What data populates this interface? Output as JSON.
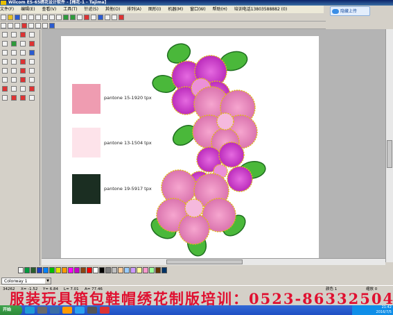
{
  "window": {
    "title": "Wilcom ES-65绣花设计软件 - [梅花-1  -  Tajima]",
    "share_button": "隐藏上传"
  },
  "menu": [
    "文件(F)",
    "编辑(E)",
    "查看(V)",
    "工具(T)",
    "针迹(S)",
    "其他(O)",
    "排列(A)",
    "图形(I)",
    "机器(M)",
    "窗口(W)",
    "帮助(H)",
    "培训电话13803588882 (0)"
  ],
  "swatches": [
    {
      "label": "pantone 15-1920 tpx",
      "color": "#ef9cb1"
    },
    {
      "label": "pantone 13-1504 tpx",
      "color": "#fde3ea"
    },
    {
      "label": "pantone 19-5917 tpx",
      "color": "#1b2e22"
    }
  ],
  "palette": [
    "#f4f4f4",
    "#009a3e",
    "#2a5f2e",
    "#1d3fbf",
    "#0080ff",
    "#00c000",
    "#e4e400",
    "#ff9900",
    "#ff00ff",
    "#c800c8",
    "#8b4513",
    "#ff0000",
    "#ffffff",
    "#000000",
    "#7f7f7f",
    "#c0c0c0",
    "#ffcc99",
    "#99ccff",
    "#cc99ff",
    "#ffff99",
    "#ff99cc",
    "#99ff99",
    "#663300",
    "#003366"
  ],
  "colorway": "Colorway 1",
  "status": {
    "stitch_count": "34262",
    "x": "X= -1.52",
    "y": "Y= 6.84",
    "l": "L= 7.01",
    "a": "A= 77.46",
    "color_label": "颜色 1",
    "zoom_label": "缩放 0"
  },
  "banner": "服装玩具箱包鞋帽绣花制版培训：0523-86332504",
  "taskbar": {
    "start": "开始",
    "clock_time": "21:42",
    "clock_date": "2016/7/5"
  }
}
